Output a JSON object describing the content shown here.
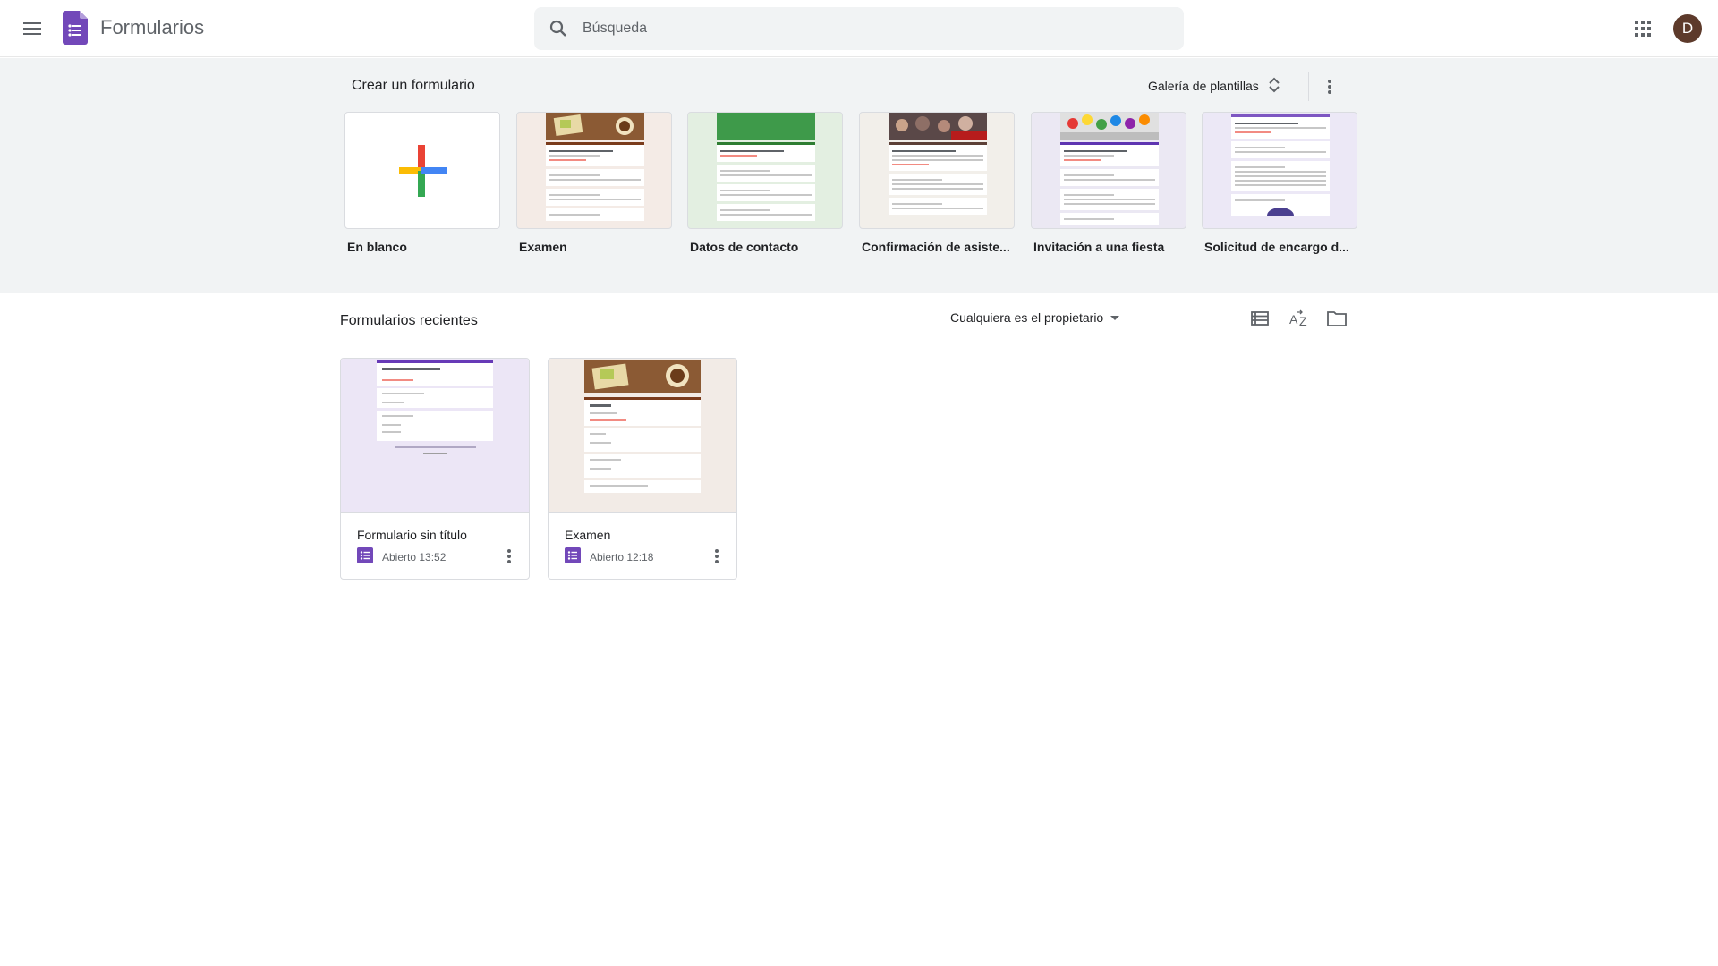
{
  "header": {
    "app_title": "Formularios",
    "search_placeholder": "Búsqueda",
    "avatar_letter": "D"
  },
  "templates": {
    "section_title": "Crear un formulario",
    "gallery_label": "Galería de plantillas",
    "items": [
      {
        "label": "En blanco"
      },
      {
        "label": "Examen"
      },
      {
        "label": "Datos de contacto"
      },
      {
        "label": "Confirmación de asiste..."
      },
      {
        "label": "Invitación a una fiesta"
      },
      {
        "label": "Solicitud de encargo d..."
      }
    ]
  },
  "recent": {
    "section_title": "Formularios recientes",
    "owner_filter": "Cualquiera es el propietario",
    "forms": [
      {
        "name": "Formulario sin título",
        "opened": "Abierto 13:52"
      },
      {
        "name": "Examen",
        "opened": "Abierto 12:18"
      }
    ]
  },
  "colors": {
    "forms_purple": "#673ab7",
    "template_bg": "#f1f3f4",
    "avatar_bg": "#5d3a2b"
  },
  "icons": [
    "menu-icon",
    "forms-logo-icon",
    "search-icon",
    "apps-icon",
    "unfold-icon",
    "more-vert-icon",
    "list-view-icon",
    "sort-az-icon",
    "folder-icon",
    "form-file-icon"
  ]
}
